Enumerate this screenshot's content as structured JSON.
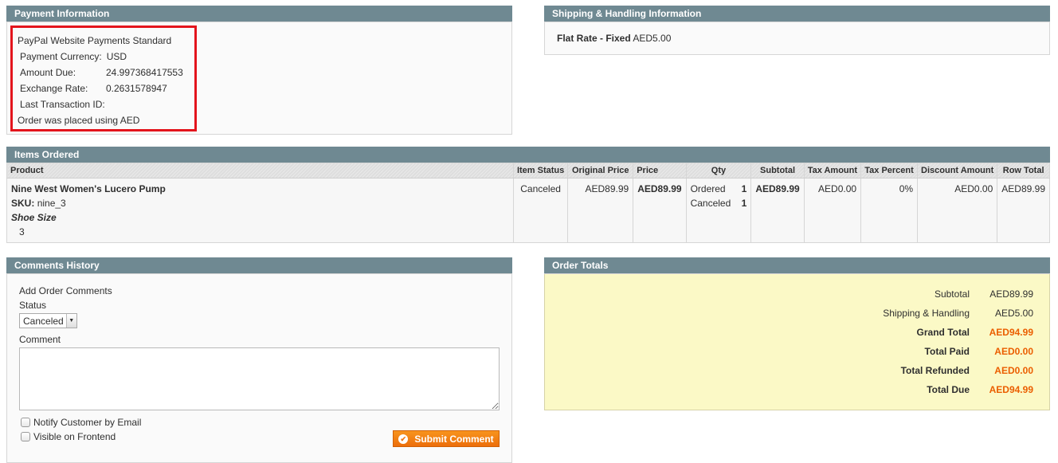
{
  "payment": {
    "title": "Payment Information",
    "method": "PayPal Website Payments Standard",
    "rows": [
      {
        "label": "Payment Currency:",
        "value": "USD"
      },
      {
        "label": "Amount Due:",
        "value": "24.997368417553"
      },
      {
        "label": "Exchange Rate:",
        "value": "0.2631578947"
      },
      {
        "label": "Last Transaction ID:",
        "value": ""
      }
    ],
    "note": "Order was placed using AED",
    "highlight_color": "#e3141c"
  },
  "shipping": {
    "title": "Shipping & Handling Information",
    "method": "Flat Rate - Fixed",
    "amount": "AED5.00"
  },
  "items": {
    "title": "Items Ordered",
    "columns": [
      "Product",
      "Item Status",
      "Original Price",
      "Price",
      "Qty",
      "Subtotal",
      "Tax Amount",
      "Tax Percent",
      "Discount Amount",
      "Row Total"
    ],
    "rows": [
      {
        "product_name": "Nine West Women's Lucero Pump",
        "sku_label": "SKU:",
        "sku": "nine_3",
        "option_label": "Shoe Size",
        "option_value": "3",
        "item_status": "Canceled",
        "original_price": "AED89.99",
        "price": "AED89.99",
        "qty": [
          {
            "label": "Ordered",
            "value": "1"
          },
          {
            "label": "Canceled",
            "value": "1"
          }
        ],
        "subtotal": "AED89.99",
        "tax_amount": "AED0.00",
        "tax_percent": "0%",
        "discount_amount": "AED0.00",
        "row_total": "AED89.99"
      }
    ]
  },
  "comments": {
    "title": "Comments History",
    "add_label": "Add Order Comments",
    "status_label": "Status",
    "status_value": "Canceled",
    "comment_label": "Comment",
    "comment_value": "",
    "notify_label": "Notify Customer by Email",
    "visible_label": "Visible on Frontend",
    "submit_label": "Submit Comment"
  },
  "totals": {
    "title": "Order Totals",
    "rows": [
      {
        "label": "Subtotal",
        "value": "AED89.99"
      },
      {
        "label": "Shipping & Handling",
        "value": "AED5.00"
      },
      {
        "label": "Grand Total",
        "value": "AED94.99"
      },
      {
        "label": "Total Paid",
        "value": "AED0.00"
      },
      {
        "label": "Total Refunded",
        "value": "AED0.00"
      },
      {
        "label": "Total Due",
        "value": "AED94.99"
      }
    ],
    "accent_color": "#eb5e00"
  }
}
